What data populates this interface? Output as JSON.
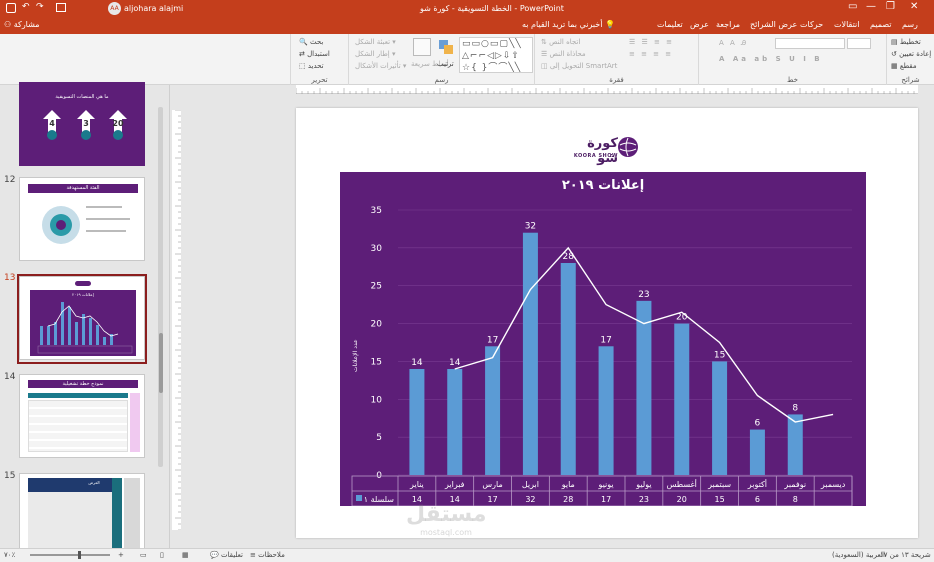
{
  "titlebar": {
    "app": "PowerPoint",
    "doc": "الخطة التسويقية - كورة شو",
    "user": "aljohara alajmi",
    "user_initials": "AA"
  },
  "tabs": [
    "ملف",
    "الصفحة الرئيسية",
    "إدراج",
    "رسم",
    "تصميم",
    "انتقالات",
    "حركات",
    "عرض الشرائح",
    "مراجعة",
    "عرض",
    "تعليمات"
  ],
  "tell_me": "أخبرني بما تريد القيام به",
  "share": "مشاركة",
  "ribbon": {
    "editing": {
      "label": "تحرير",
      "find": "بحث",
      "replace": "استبدال",
      "select": "تحديد"
    },
    "drawing": {
      "label": "رسم",
      "fill": "تعبئة الشكل",
      "outline": "إطار الشكل",
      "effects": "تأثيرات الأشكال",
      "arrange": "ترتيب",
      "quick_styles": "أنماط سريعة"
    },
    "paragraph": {
      "label": "فقرة",
      "text_direction": "اتجاه النص",
      "align_text": "محاذاة النص",
      "smartart": "التحويل إلى SmartArt"
    },
    "font": {
      "label": "خط"
    },
    "slides": {
      "label": "شرائح",
      "layout": "تخطيط",
      "reset": "إعادة تعيين",
      "section": "مقطع"
    }
  },
  "slides": [
    {
      "num": "",
      "title": "ما هي المنصات التسويقية",
      "values": [
        "4",
        "3",
        "20"
      ]
    },
    {
      "num": "12",
      "title": "الفئة المستهدفة"
    },
    {
      "num": "13",
      "title": "إعلانات ٢٠١٩"
    },
    {
      "num": "14",
      "title": "نموذج خطة تشغيلية"
    },
    {
      "num": "15",
      "title": "العرض"
    }
  ],
  "logo": {
    "arabic": "كورة شو",
    "latin": "KOORA SHOW"
  },
  "chart_data": {
    "type": "bar",
    "title": "إعلانات ٢٠١٩",
    "ylabel": "عدد الإعلانات",
    "ylim": [
      0,
      35
    ],
    "yticks": [
      0,
      5,
      10,
      15,
      20,
      25,
      30,
      35
    ],
    "categories": [
      "يناير",
      "فبراير",
      "مارس",
      "ابريل",
      "مايو",
      "يونيو",
      "يوليو",
      "أغسطس",
      "سبتمبر",
      "أكتوبر",
      "نوفمبر",
      "ديسمبر"
    ],
    "series": [
      {
        "name": "سلسلة ١",
        "values": [
          14,
          14,
          17,
          32,
          28,
          17,
          23,
          20,
          15,
          6,
          8,
          null
        ]
      }
    ],
    "trendline": [
      null,
      14,
      15.5,
      24.5,
      30,
      22.5,
      20,
      21.5,
      17.5,
      10.5,
      7,
      8
    ],
    "data_table": true,
    "colors": {
      "bg": "#5d1e78",
      "bar": "#5b9bd5",
      "line": "#ffffff",
      "grid": "#7a3c92"
    }
  },
  "status": {
    "slide_info": "شريحة ١٣ من ١٧",
    "language": "العربية (السعودية)",
    "notes": "ملاحظات",
    "comments": "تعليقات",
    "zoom": "٧٠٪"
  },
  "watermark": {
    "arabic": "مستقل",
    "latin": "mostaql.com"
  }
}
